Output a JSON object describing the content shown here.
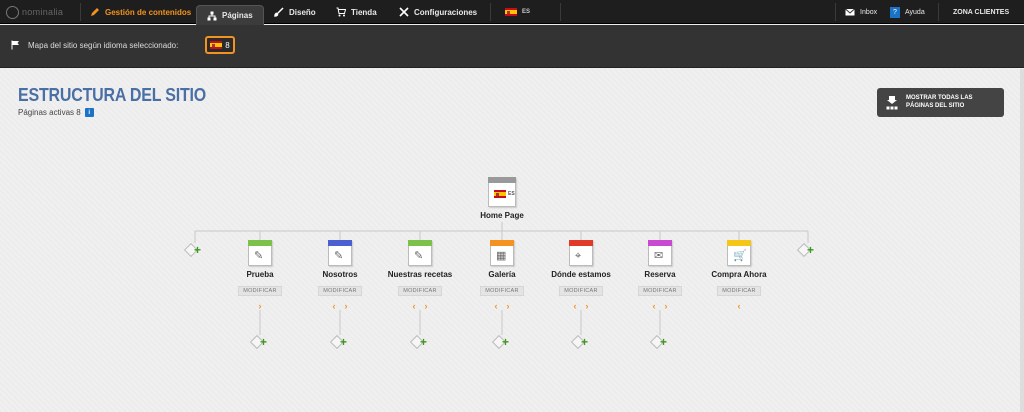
{
  "nav": {
    "logo_text": "nominalia",
    "items": [
      {
        "label": "Gestión de contenidos",
        "icon": "pencil-icon"
      },
      {
        "label": "Páginas",
        "icon": "sitemap-icon"
      },
      {
        "label": "Diseño",
        "icon": "brush-icon"
      },
      {
        "label": "Tienda",
        "icon": "cart-icon"
      },
      {
        "label": "Configuraciones",
        "icon": "tools-icon"
      }
    ],
    "language_code": "ES",
    "inbox_label": "Inbox",
    "help_badge": "?",
    "help_label": "Ayuda",
    "client_zone_label": "ZONA CLIENTES"
  },
  "subbar": {
    "label": "Mapa del sitio según idioma seleccionado:",
    "selected_count": "8"
  },
  "page": {
    "title": "ESTRUCTURA DEL SITIO",
    "active_pages": "Páginas activas 8",
    "info_icon": "i",
    "show_all_label": "MOSTRAR TODAS LAS PÁGINAS DEL SITIO"
  },
  "tree": {
    "home": {
      "label": "Home Page",
      "lang_code": "ES"
    },
    "modify_label": "MODIFICAR",
    "pages": [
      {
        "label": "Prueba",
        "color": "#7cc24a",
        "glyph": "✎",
        "left": false,
        "right": true
      },
      {
        "label": "Nosotros",
        "color": "#4a5fd0",
        "glyph": "✎",
        "left": true,
        "right": true
      },
      {
        "label": "Nuestras recetas",
        "color": "#7cc24a",
        "glyph": "✎",
        "left": true,
        "right": true
      },
      {
        "label": "Galería",
        "color": "#f39221",
        "glyph": "▦",
        "left": true,
        "right": true
      },
      {
        "label": "Dónde estamos",
        "color": "#e03a2a",
        "glyph": "⌖",
        "left": true,
        "right": true
      },
      {
        "label": "Reserva",
        "color": "#c84ad0",
        "glyph": "✉",
        "left": true,
        "right": true
      },
      {
        "label": "Compra Ahora",
        "color": "#f5c518",
        "glyph": "🛒",
        "left": true,
        "right": false
      }
    ]
  }
}
